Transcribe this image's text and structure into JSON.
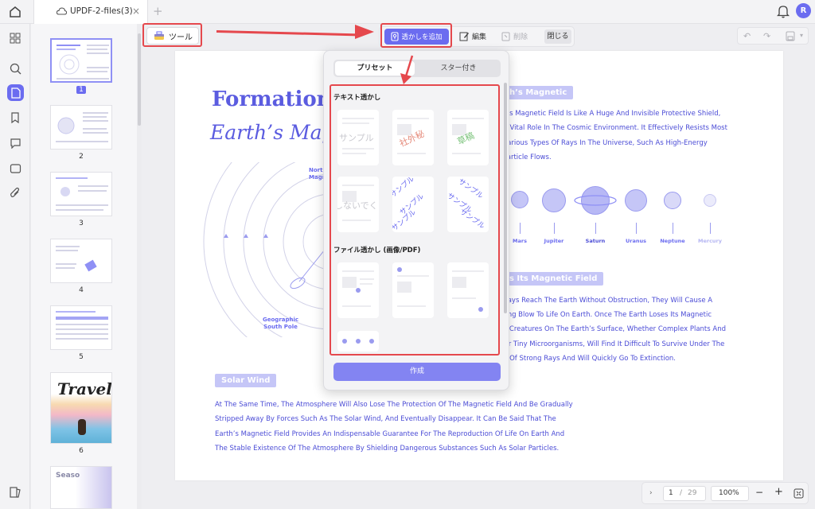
{
  "titlebar": {
    "tab_title": "UPDF-2-files(3)",
    "tab_close": "×",
    "tab_add": "+",
    "avatar_initial": "R"
  },
  "thumbnails": [
    {
      "page": "1",
      "selected": true
    },
    {
      "page": "2"
    },
    {
      "page": "3"
    },
    {
      "page": "4"
    },
    {
      "page": "5"
    },
    {
      "page": "6",
      "cover_title": "Travel"
    },
    {
      "page": "",
      "cover_title": "Seaso"
    }
  ],
  "toolbar": {
    "tools_label": "ツール",
    "add_watermark_label": "透かしを追加",
    "edit_label": "編集",
    "delete_label": "削除",
    "close_label": "閉じる"
  },
  "popup": {
    "tab_preset": "プリセット",
    "tab_starred": "スター付き",
    "text_section": "テキスト透かし",
    "file_section": "ファイル透かし (画像/PDF)",
    "text_samples": [
      "サンプル",
      "社外秘",
      "草稿",
      "しないでく",
      "サンプル",
      "サンプル"
    ],
    "create_label": "作成",
    "colors": {
      "sample_gray": "#c9c9cf",
      "confidential": "#e58a7a",
      "draft": "#7ac27a",
      "diag": "#6b6cf0"
    }
  },
  "document": {
    "heading_1": "Formation O",
    "heading_2": "Earth’s Magn",
    "section_magnetic": "h’s Magnetic",
    "para1": [
      "h’s Magnetic Field Is Like A Huge And Invisible Protective Shield,",
      "A Vital Role In The Cosmic Environment. It Effectively Resists Most",
      "Various Types Of Rays In The Universe, Such As High-Energy",
      "Particle Flows."
    ],
    "planets": [
      "Mars",
      "Jupiter",
      "Saturn",
      "Uranus",
      "Neptune",
      "Mercury"
    ],
    "diagram_north": "North",
    "diagram_magn": "Magn",
    "diagram_south_1": "Geographic",
    "diagram_south_2": "South Pole",
    "section_field": "s Its Magnetic Field",
    "para2": [
      "Rays Reach The Earth Without Obstruction, They Will Cause A",
      "ting Blow To Life On Earth. Once The Earth Loses Its Magnetic",
      "e Creatures On The Earth’s Surface, Whether Complex Plants And",
      "Or Tiny Microorganisms, Will Find It Difficult To Survive Under The",
      "n Of Strong Rays And Will Quickly Go To Extinction."
    ],
    "section_wind": "Solar Wind",
    "para3": [
      "At The Same Time, The Atmosphere Will Also Lose The Protection Of The Magnetic Field And Be Gradually",
      "Stripped Away By Forces Such As The Solar Wind, And Eventually Disappear. It Can Be Said That The",
      "Earth’s Magnetic Field Provides An Indispensable Guarantee For The Reproduction Of Life On Earth And",
      "The Stable Existence Of The Atmosphere By Shielding Dangerous Substances Such As Solar Particles."
    ]
  },
  "bottombar": {
    "current_page": "1",
    "separator": "/",
    "total_pages": "29",
    "zoom": "100%",
    "zoom_out": "−",
    "zoom_in": "+"
  },
  "accent": "#6b6cf0",
  "annotation_color": "#e5484d"
}
